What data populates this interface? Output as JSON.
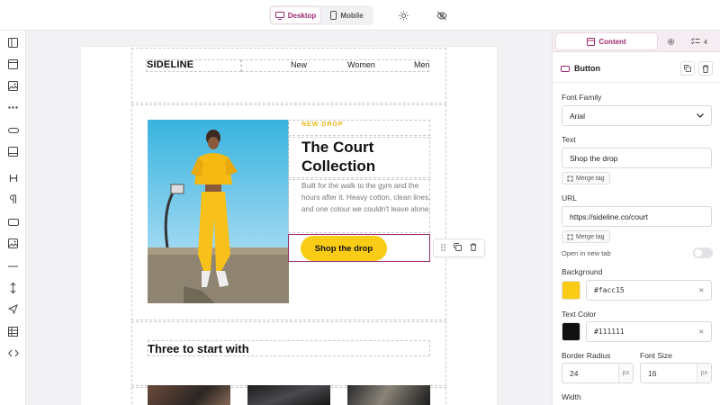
{
  "toolbar": {
    "device_desktop": "Desktop",
    "device_mobile": "Mobile",
    "theme_icon": "sun-icon",
    "hide_icon": "eye-off-icon"
  },
  "rail": [
    "sidebar-layout-icon",
    "section-icon",
    "image-block-icon",
    "more-icon",
    "divider-block-icon",
    "footer-block-icon",
    "heading-icon",
    "paragraph-icon",
    "button-block-icon",
    "image-icon",
    "line-icon",
    "spacer-icon",
    "send-icon",
    "table-icon",
    "code-icon"
  ],
  "email": {
    "brand": "SIDELINE",
    "nav": [
      "New",
      "Women",
      "Men"
    ],
    "hero": {
      "eyebrow": "NEW DROP",
      "headline": "The Court Collection",
      "body": "Built for the walk to the gym and the hours after it. Heavy cotton, clean lines, and one colour we couldn't leave alone.",
      "cta": "Shop the drop"
    },
    "section_title": "Three to start with"
  },
  "panel": {
    "tab_content": "Content",
    "checklist_count": "4",
    "block_title": "Button",
    "font_family_label": "Font Family",
    "font_family_value": "Arial",
    "text_label": "Text",
    "text_value": "Shop the drop",
    "merge_tag": "Merge tag",
    "url_label": "URL",
    "url_value": "https://sideline.co/court",
    "new_tab_label": "Open in new tab",
    "new_tab_enabled": false,
    "background_label": "Background",
    "background_value": "#facc15",
    "text_color_label": "Text Color",
    "text_color_value": "#111111",
    "border_radius_label": "Border Radius",
    "border_radius_value": "24",
    "font_size_label": "Font Size",
    "font_size_value": "16",
    "unit": "px",
    "width_label": "Width"
  },
  "colors": {
    "accent": "#9d2a6f",
    "cta": "#facc15",
    "text": "#111111"
  }
}
